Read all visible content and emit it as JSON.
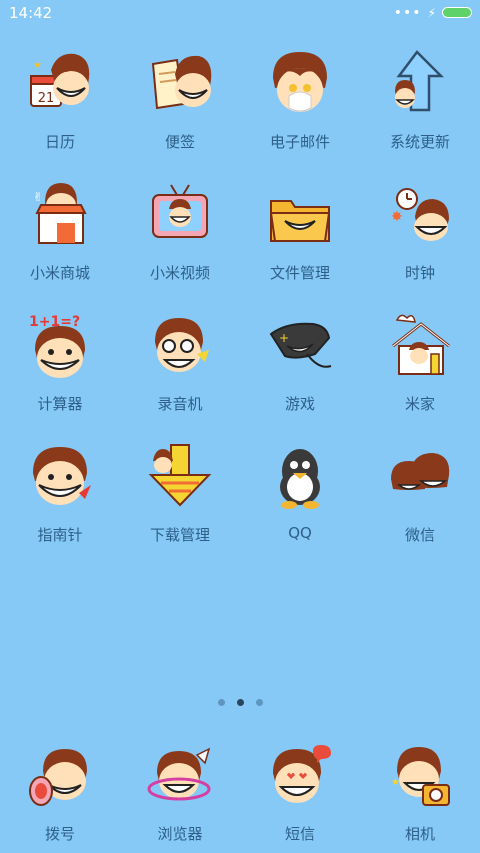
{
  "status_bar": {
    "time": "14:42"
  },
  "apps": [
    {
      "label": "日历",
      "icon": "calendar-icon"
    },
    {
      "label": "便签",
      "icon": "notes-icon"
    },
    {
      "label": "电子邮件",
      "icon": "email-icon"
    },
    {
      "label": "系统更新",
      "icon": "system-update-icon"
    },
    {
      "label": "小米商城",
      "icon": "mi-store-icon"
    },
    {
      "label": "小米视频",
      "icon": "mi-video-icon"
    },
    {
      "label": "文件管理",
      "icon": "file-manager-icon"
    },
    {
      "label": "时钟",
      "icon": "clock-icon"
    },
    {
      "label": "计算器",
      "icon": "calculator-icon"
    },
    {
      "label": "录音机",
      "icon": "recorder-icon"
    },
    {
      "label": "游戏",
      "icon": "games-icon"
    },
    {
      "label": "米家",
      "icon": "mi-home-icon"
    },
    {
      "label": "指南针",
      "icon": "compass-icon"
    },
    {
      "label": "下载管理",
      "icon": "download-manager-icon"
    },
    {
      "label": "QQ",
      "icon": "qq-icon"
    },
    {
      "label": "微信",
      "icon": "wechat-icon"
    }
  ],
  "calendar_date": "21",
  "calculator_text": "1+1=?",
  "dock": [
    {
      "label": "拨号",
      "icon": "phone-icon"
    },
    {
      "label": "浏览器",
      "icon": "browser-icon"
    },
    {
      "label": "短信",
      "icon": "messages-icon"
    },
    {
      "label": "相机",
      "icon": "camera-icon"
    }
  ],
  "pager": {
    "pages": 3,
    "current": 2
  },
  "colors": {
    "background": "#86c9f7",
    "label": "#2d5f88",
    "hair": "#8a3a1a",
    "skin": "#ffe0b8"
  }
}
